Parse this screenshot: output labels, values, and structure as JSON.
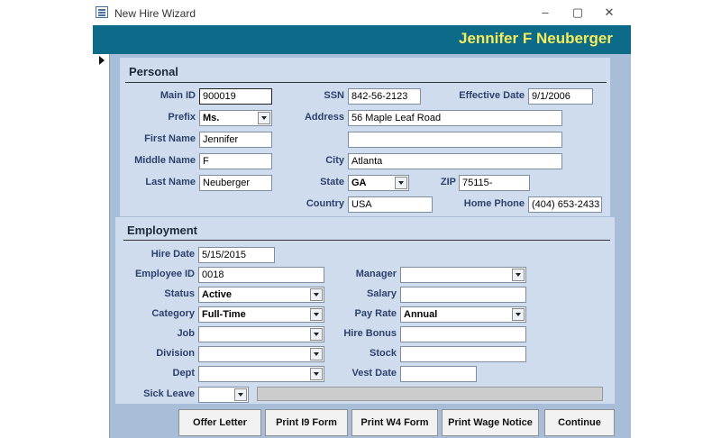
{
  "window": {
    "title": "New Hire Wizard",
    "minimize": "–",
    "restore": "▢",
    "close": "✕"
  },
  "header": {
    "employee_name": "Jennifer F Neuberger"
  },
  "personal": {
    "title": "Personal",
    "main_id": {
      "label": "Main ID",
      "value": "900019"
    },
    "ssn": {
      "label": "SSN",
      "value": "842-56-2123"
    },
    "effective_date": {
      "label": "Effective Date",
      "value": "9/1/2006"
    },
    "prefix": {
      "label": "Prefix",
      "value": "Ms."
    },
    "address": {
      "label": "Address",
      "value": "56 Maple Leaf Road",
      "value2": ""
    },
    "first_name": {
      "label": "First Name",
      "value": "Jennifer"
    },
    "middle_name": {
      "label": "Middle Name",
      "value": "F"
    },
    "city": {
      "label": "City",
      "value": "Atlanta"
    },
    "last_name": {
      "label": "Last Name",
      "value": "Neuberger"
    },
    "state": {
      "label": "State",
      "value": "GA"
    },
    "zip": {
      "label": "ZIP",
      "value": "75115-"
    },
    "country": {
      "label": "Country",
      "value": "USA"
    },
    "home_phone": {
      "label": "Home Phone",
      "value": "(404) 653-2433"
    }
  },
  "employment": {
    "title": "Employment",
    "hire_date": {
      "label": "Hire Date",
      "value": "5/15/2015"
    },
    "employee_id": {
      "label": "Employee ID",
      "value": "0018"
    },
    "manager": {
      "label": "Manager",
      "value": ""
    },
    "status": {
      "label": "Status",
      "value": "Active"
    },
    "salary": {
      "label": "Salary",
      "value": ""
    },
    "category": {
      "label": "Category",
      "value": "Full-Time"
    },
    "pay_rate": {
      "label": "Pay Rate",
      "value": "Annual"
    },
    "job": {
      "label": "Job",
      "value": ""
    },
    "hire_bonus": {
      "label": "Hire Bonus",
      "value": ""
    },
    "division": {
      "label": "Division",
      "value": ""
    },
    "stock": {
      "label": "Stock",
      "value": ""
    },
    "dept": {
      "label": "Dept",
      "value": ""
    },
    "vest_date": {
      "label": "Vest Date",
      "value": ""
    },
    "sick_leave": {
      "label": "Sick Leave",
      "value": ""
    }
  },
  "buttons": {
    "offer_letter": "Offer Letter",
    "print_i9": "Print I9 Form",
    "print_w4": "Print W4 Form",
    "print_wage": "Print Wage Notice",
    "continue": "Continue"
  }
}
